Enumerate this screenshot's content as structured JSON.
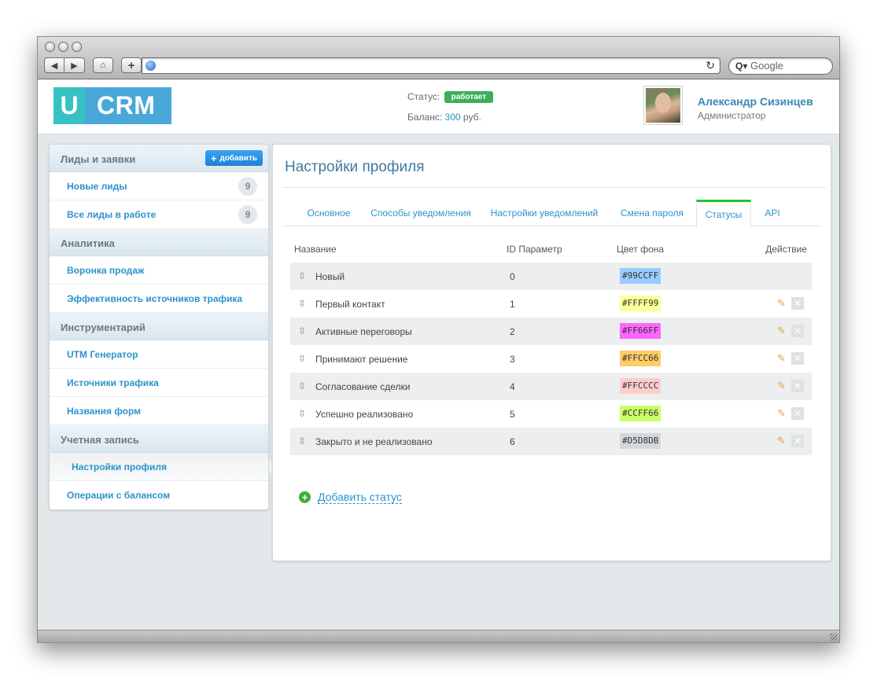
{
  "browser": {
    "search_placeholder": "Google",
    "search_prefix": "Q▾"
  },
  "header": {
    "logo_left": "U",
    "logo_right": "CRM",
    "status_label": "Статус:",
    "status_value": "работает",
    "balance_label": "Баланс:",
    "balance_value": "300",
    "balance_unit": "руб.",
    "user_name": "Александр Сизинцев",
    "user_role": "Администратор"
  },
  "sidebar": {
    "sections": [
      {
        "title": "Лиды и заявки",
        "add_label": "добавить"
      },
      {
        "title": "Аналитика"
      },
      {
        "title": "Инструментарий"
      },
      {
        "title": "Учетная запись"
      }
    ],
    "leads": [
      {
        "label": "Новые лиды",
        "count": "9"
      },
      {
        "label": "Все лиды в работе",
        "count": "9"
      }
    ],
    "analytics": [
      {
        "label": "Воронка продаж"
      },
      {
        "label": "Эффективность источников трафика"
      }
    ],
    "tools": [
      {
        "label": "UTM Генератор"
      },
      {
        "label": "Источники трафика"
      },
      {
        "label": "Названия форм"
      }
    ],
    "account": [
      {
        "label": "Настройки профиля"
      },
      {
        "label": "Операции с балансом"
      }
    ]
  },
  "main": {
    "title": "Настройки профиля",
    "tabs": [
      {
        "label": "Основное"
      },
      {
        "label": "Способы уведомления"
      },
      {
        "label": "Настройки уведомлений"
      },
      {
        "label": "Смена пароля"
      },
      {
        "label": "Статусы"
      },
      {
        "label": "API"
      }
    ],
    "active_tab": "Статусы",
    "columns": {
      "name": "Название",
      "id": "ID Параметр",
      "color": "Цвет фона",
      "action": "Действие"
    },
    "rows": [
      {
        "name": "Новый",
        "id": "0",
        "color": "#99CCFF",
        "has_actions": false
      },
      {
        "name": "Первый контакт",
        "id": "1",
        "color": "#FFFF99",
        "has_actions": true
      },
      {
        "name": "Активные переговоры",
        "id": "2",
        "color": "#FF66FF",
        "has_actions": true
      },
      {
        "name": "Принимают решение",
        "id": "3",
        "color": "#FFCC66",
        "has_actions": true
      },
      {
        "name": "Согласование сделки",
        "id": "4",
        "color": "#FFCCCC",
        "has_actions": true
      },
      {
        "name": "Успешно реализовано",
        "id": "5",
        "color": "#CCFF66",
        "has_actions": true
      },
      {
        "name": "Закрыто и не реализовано",
        "id": "6",
        "color": "#D5D8DB",
        "has_actions": true
      }
    ],
    "add_status_label": "Добавить статус"
  },
  "icons": {
    "drag": "⇳",
    "edit": "✎",
    "delete": "✕",
    "add": "+",
    "home": "⌂",
    "back": "◀",
    "forward": "▶",
    "reload": "↻"
  },
  "colors": {
    "accent": "#2b93cc",
    "status_badge": "#3dae5a",
    "active_tab": "#22c52e",
    "add_button": "#1d82d8"
  }
}
